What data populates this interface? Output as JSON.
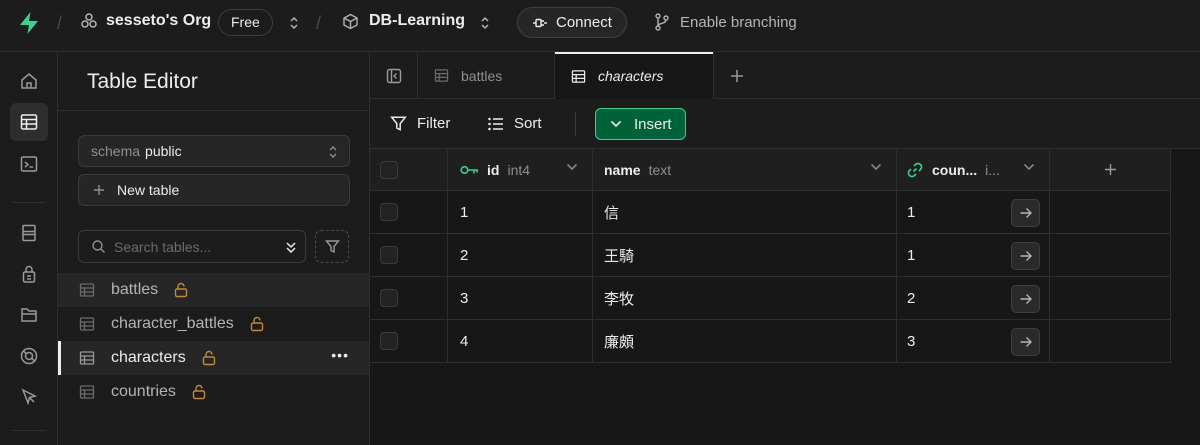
{
  "topbar": {
    "org_name": "sesseto's Org",
    "plan_badge": "Free",
    "project_name": "DB-Learning",
    "connect_label": "Connect",
    "branching_label": "Enable branching"
  },
  "sidebar": {
    "title": "Table Editor",
    "schema_label": "schema",
    "schema_value": "public",
    "new_table_label": "New table",
    "search_placeholder": "Search tables...",
    "tables": [
      {
        "name": "battles",
        "state": "hover"
      },
      {
        "name": "character_battles",
        "state": "normal"
      },
      {
        "name": "characters",
        "state": "active"
      },
      {
        "name": "countries",
        "state": "normal"
      }
    ],
    "more_label": "•••"
  },
  "tabs": [
    {
      "label": "battles",
      "active": false
    },
    {
      "label": "characters",
      "active": true
    }
  ],
  "toolbar": {
    "filter_label": "Filter",
    "sort_label": "Sort",
    "insert_label": "Insert"
  },
  "grid": {
    "columns": [
      {
        "name": "id",
        "type": "int4",
        "icon": "key-icon"
      },
      {
        "name": "name",
        "type": "text",
        "icon": ""
      },
      {
        "name": "coun...",
        "type": "i...",
        "icon": "link-icon"
      }
    ],
    "add_column_label": "+",
    "rows": [
      {
        "id": "1",
        "name": "信",
        "country": "1"
      },
      {
        "id": "2",
        "name": "王騎",
        "country": "1"
      },
      {
        "id": "3",
        "name": "李牧",
        "country": "2"
      },
      {
        "id": "4",
        "name": "廉頗",
        "country": "3"
      }
    ]
  },
  "colors": {
    "brand": "#3ecf8e",
    "insert_bg": "#006239",
    "lock": "#c08a3e",
    "background": "#1c1c1c"
  }
}
